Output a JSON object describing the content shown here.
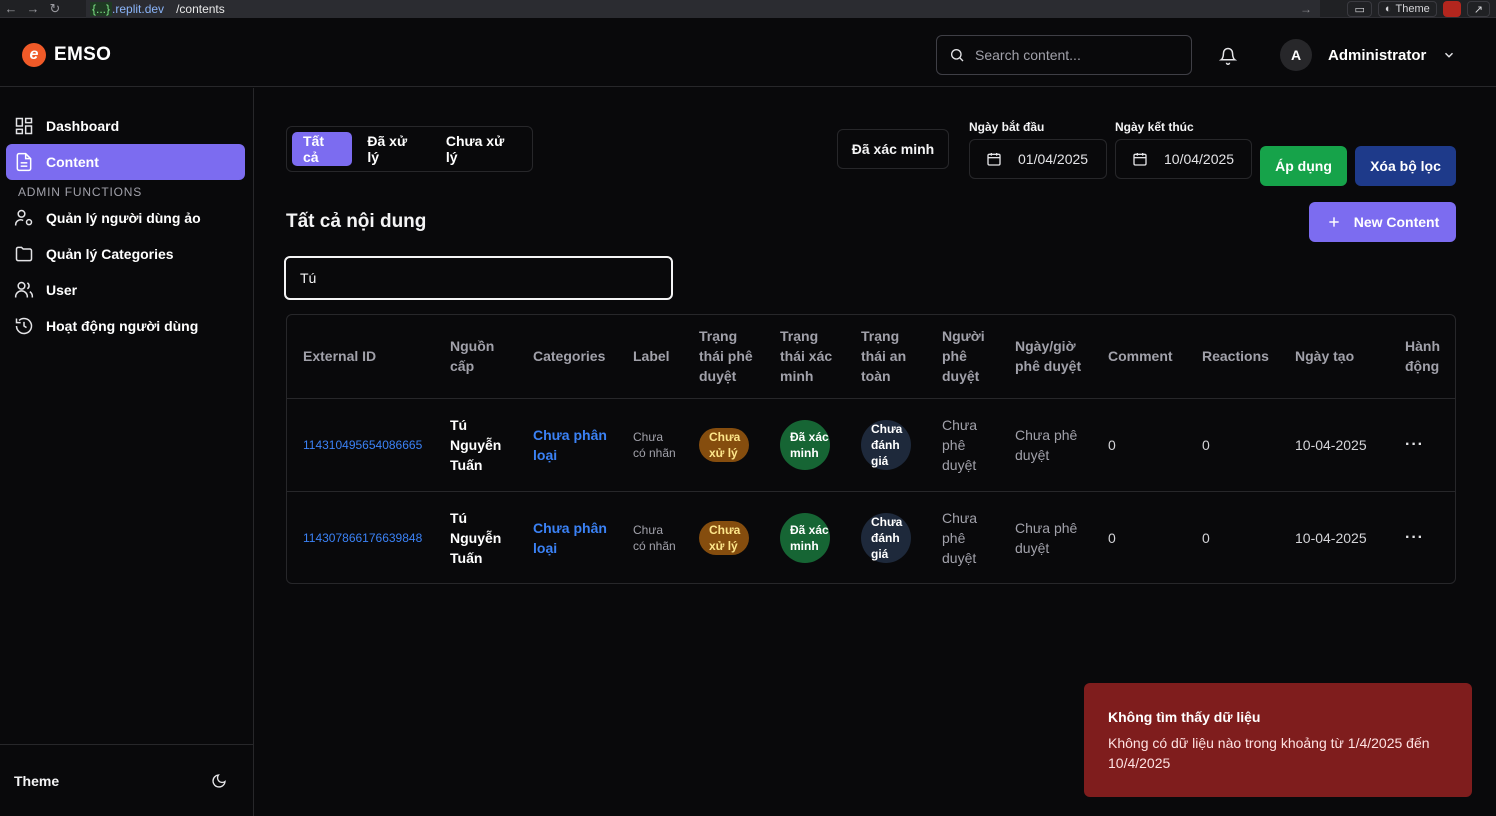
{
  "browser": {
    "url_host": "{...}",
    "url_host_suffix": ".replit.dev",
    "url_path": "/contents",
    "theme_button": "Theme"
  },
  "header": {
    "logo_text": "EMSO",
    "logo_glyph": "e",
    "search_placeholder": "Search content...",
    "user_initial": "A",
    "user_name": "Administrator"
  },
  "sidebar": {
    "items": [
      {
        "label": "Dashboard",
        "icon": "grid-icon",
        "active": false
      },
      {
        "label": "Content",
        "icon": "document-icon",
        "active": true
      }
    ],
    "admin_label": "ADMIN FUNCTIONS",
    "admin_items": [
      {
        "label": "Quản lý người dùng ảo",
        "icon": "user-cog-icon"
      },
      {
        "label": "Quản lý Categories",
        "icon": "folder-icon"
      },
      {
        "label": "User",
        "icon": "users-icon"
      },
      {
        "label": "Hoạt động người dùng",
        "icon": "history-icon"
      }
    ],
    "footer_label": "Theme"
  },
  "filters": {
    "tabs": [
      "Tất cả",
      "Đã xử lý",
      "Chưa xử lý"
    ],
    "active_tab": "Tất cả",
    "verified_button": "Đã xác minh",
    "start_label": "Ngày bắt đầu",
    "start_value": "01/04/2025",
    "end_label": "Ngày kết thúc",
    "end_value": "10/04/2025",
    "apply_button": "Áp dụng",
    "clear_button": "Xóa bộ lọc"
  },
  "content": {
    "title": "Tất cả nội dung",
    "new_button": "New Content",
    "search_value": "Tú"
  },
  "table": {
    "headers": [
      "External ID",
      "Nguồn cấp",
      "Categories",
      "Label",
      "Trạng thái phê duyệt",
      "Trạng thái xác minh",
      "Trạng thái an toàn",
      "Người phê duyệt",
      "Ngày/giờ phê duyệt",
      "Comment",
      "Reactions",
      "Ngày tạo",
      "Hành động"
    ],
    "rows": [
      {
        "id": "114310495654086665",
        "source": "Tú Nguyễn Tuấn",
        "category": "Chưa phân loại",
        "label": "Chưa có nhãn",
        "approval": "Chưa xử lý",
        "verification": "Đã xác minh",
        "safety": "Chưa đánh giá",
        "approver": "Chưa phê duyệt",
        "approved_at": "Chưa phê duyệt",
        "comment": "0",
        "reactions": "0",
        "created": "10-04-2025",
        "action": "···"
      },
      {
        "id": "114307866176639848",
        "source": "Tú Nguyễn Tuấn",
        "category": "Chưa phân loại",
        "label": "Chưa có nhãn",
        "approval": "Chưa xử lý",
        "verification": "Đã xác minh",
        "safety": "Chưa đánh giá",
        "approver": "Chưa phê duyệt",
        "approved_at": "Chưa phê duyệt",
        "comment": "0",
        "reactions": "0",
        "created": "10-04-2025",
        "action": "···"
      }
    ]
  },
  "toast": {
    "title": "Không tìm thấy dữ liệu",
    "message": "Không có dữ liệu nào trong khoảng từ 1/4/2025 đến 10/4/2025"
  },
  "colors": {
    "accent": "#7c6cf0",
    "green": "#16a34a",
    "navy": "#1e3a8a",
    "link": "#3b82f6",
    "toast_bg": "#7f1d1d"
  }
}
